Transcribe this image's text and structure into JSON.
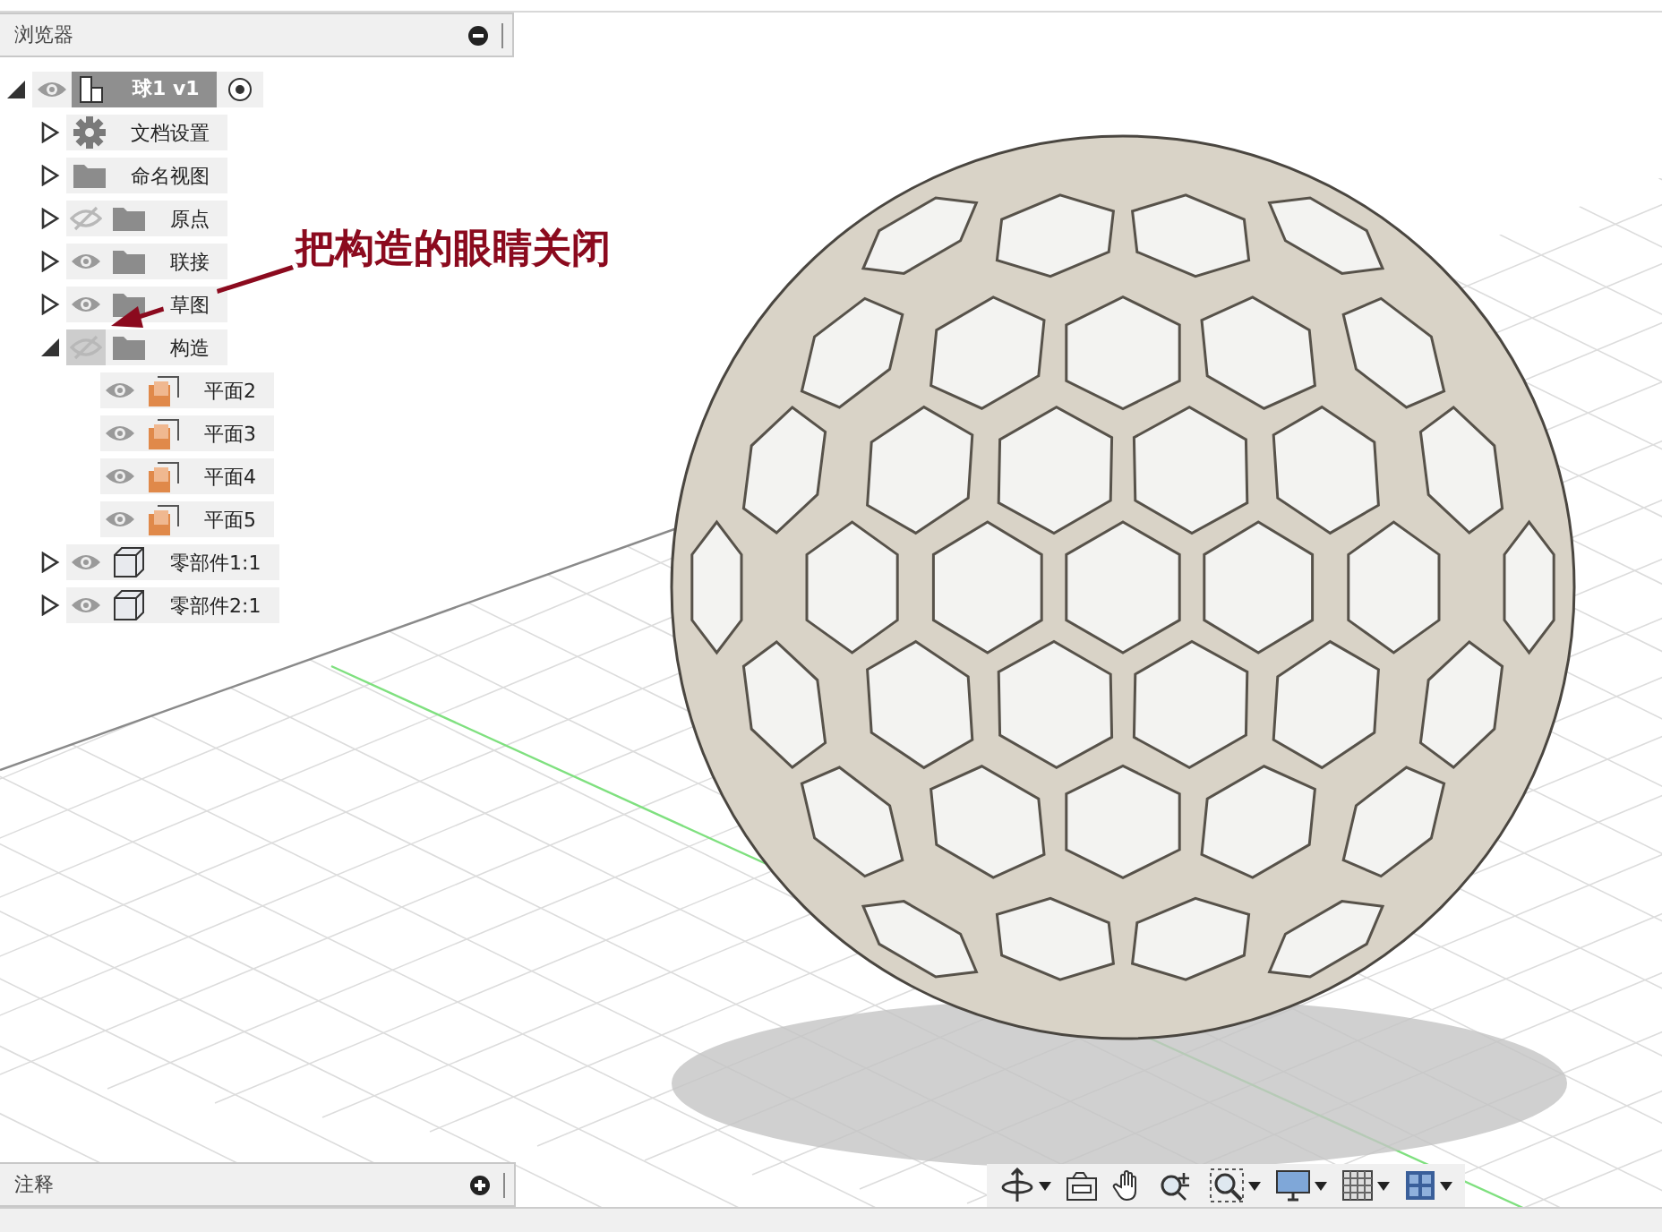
{
  "browser": {
    "title": "浏览器",
    "tree": {
      "label": "球1 v1",
      "kind": "root",
      "visible": true,
      "expanded": true,
      "hovered": false,
      "children": [
        {
          "label": "文档设置",
          "kind": "settings",
          "expanded": false,
          "hovered": false
        },
        {
          "label": "命名视图",
          "kind": "folder",
          "expanded": false,
          "hovered": false
        },
        {
          "label": "原点",
          "kind": "folder",
          "visible": false,
          "expanded": false,
          "hovered": false
        },
        {
          "label": "联接",
          "kind": "folder",
          "visible": true,
          "expanded": false,
          "hovered": false
        },
        {
          "label": "草图",
          "kind": "folder",
          "visible": true,
          "expanded": false,
          "hovered": false
        },
        {
          "label": "构造",
          "kind": "folder",
          "visible": false,
          "expanded": true,
          "hovered": true,
          "children": [
            {
              "label": "平面2",
              "kind": "plane",
              "visible": true,
              "hovered": false
            },
            {
              "label": "平面3",
              "kind": "plane",
              "visible": true,
              "hovered": false
            },
            {
              "label": "平面4",
              "kind": "plane",
              "visible": true,
              "hovered": false
            },
            {
              "label": "平面5",
              "kind": "plane",
              "visible": true,
              "hovered": false
            }
          ]
        },
        {
          "label": "零部件1:1",
          "kind": "component",
          "visible": true,
          "expanded": false,
          "hovered": false
        },
        {
          "label": "零部件2:1",
          "kind": "component",
          "visible": true,
          "expanded": false,
          "hovered": false
        }
      ]
    }
  },
  "annotation": {
    "text": "把构造的眼睛关闭"
  },
  "comments_panel": {
    "title": "注释"
  }
}
